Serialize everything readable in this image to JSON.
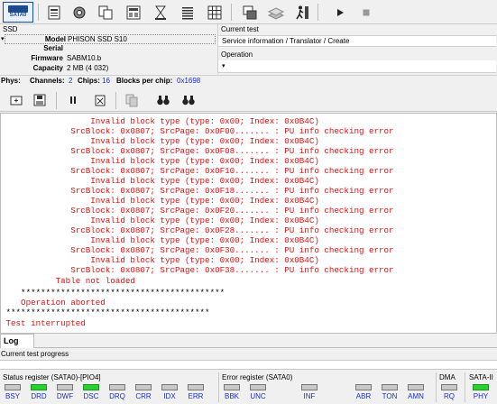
{
  "toolbar": {
    "sata_label": "SATA0",
    "icons": [
      "sata-port-icon",
      "drive-info-icon",
      "settings-icon",
      "copy-icon",
      "table-icon",
      "hourglass-icon",
      "list-icon",
      "grid-icon",
      "windows-icon",
      "stack-icon",
      "person-run-icon",
      "play-icon",
      "stop-icon"
    ]
  },
  "ssd": {
    "title": "SSD",
    "model_label": "Model",
    "model_value": "PHISON SSD S10",
    "serial_label": "Serial",
    "serial_value": "",
    "firmware_label": "Firmware",
    "firmware_value": "SABM10.b",
    "capacity_label": "Capacity",
    "capacity_value": "2 MB (4 032)"
  },
  "current_test": {
    "label": "Current test",
    "value": "Service information / Translator / Create",
    "operation_label": "Operation",
    "operation_value": ""
  },
  "phys": {
    "phys_label": "Phys:",
    "channels_label": "Channels:",
    "channels_value": "2",
    "chips_label": "Chips:",
    "chips_value": "16",
    "blocks_label": "Blocks per chip:",
    "blocks_value": "0x1698"
  },
  "log": {
    "lines": [
      {
        "text": "                  Invalid block type (type: 0x00; Index: 0x0B4C)",
        "color": "red"
      },
      {
        "text": "              SrcBlock: 0x0807; SrcPage: 0x0F00....... : PU info checking error",
        "color": "red"
      },
      {
        "text": "                  Invalid block type (type: 0x00; Index: 0x0B4C)",
        "color": "red"
      },
      {
        "text": "              SrcBlock: 0x0807; SrcPage: 0x0F08....... : PU info checking error",
        "color": "red"
      },
      {
        "text": "                  Invalid block type (type: 0x00; Index: 0x0B4C)",
        "color": "red"
      },
      {
        "text": "              SrcBlock: 0x0807; SrcPage: 0x0F10....... : PU info checking error",
        "color": "red"
      },
      {
        "text": "                  Invalid block type (type: 0x00; Index: 0x0B4C)",
        "color": "red"
      },
      {
        "text": "              SrcBlock: 0x0807; SrcPage: 0x0F18....... : PU info checking error",
        "color": "red"
      },
      {
        "text": "                  Invalid block type (type: 0x00; Index: 0x0B4C)",
        "color": "red"
      },
      {
        "text": "              SrcBlock: 0x0807; SrcPage: 0x0F20....... : PU info checking error",
        "color": "red"
      },
      {
        "text": "                  Invalid block type (type: 0x00; Index: 0x0B4C)",
        "color": "red"
      },
      {
        "text": "              SrcBlock: 0x0807; SrcPage: 0x0F28....... : PU info checking error",
        "color": "red"
      },
      {
        "text": "                  Invalid block type (type: 0x00; Index: 0x0B4C)",
        "color": "red"
      },
      {
        "text": "              SrcBlock: 0x0807; SrcPage: 0x0F30....... : PU info checking error",
        "color": "red"
      },
      {
        "text": "                  Invalid block type (type: 0x00; Index: 0x0B4C)",
        "color": "red"
      },
      {
        "text": "              SrcBlock: 0x0807; SrcPage: 0x0F38....... : PU info checking error",
        "color": "red"
      },
      {
        "text": "           Table not loaded",
        "color": "red"
      },
      {
        "text": "    *****************************************",
        "color": "black"
      },
      {
        "text": "    Operation aborted",
        "color": "red"
      },
      {
        "text": " *****************************************",
        "color": "black"
      },
      {
        "text": " Test interrupted",
        "color": "red"
      }
    ]
  },
  "tabs": {
    "log_label": "Log"
  },
  "progress": {
    "label": "Current test progress",
    "fraction": 0
  },
  "status_register": {
    "title": "Status register (SATA0)-[PIO4]",
    "flags": [
      {
        "name": "BSY",
        "on": false
      },
      {
        "name": "DRD",
        "on": true
      },
      {
        "name": "DWF",
        "on": false
      },
      {
        "name": "DSC",
        "on": true
      },
      {
        "name": "DRQ",
        "on": false
      },
      {
        "name": "CRR",
        "on": false
      },
      {
        "name": "IDX",
        "on": false
      },
      {
        "name": "ERR",
        "on": false
      }
    ]
  },
  "error_register": {
    "title": "Error register (SATA0)",
    "flags": [
      {
        "name": "BBK",
        "on": false
      },
      {
        "name": "UNC",
        "on": false
      },
      {
        "name": "INF",
        "on": false
      },
      {
        "name": "ABR",
        "on": false
      },
      {
        "name": "TON",
        "on": false
      },
      {
        "name": "AMN",
        "on": false
      }
    ]
  },
  "dma_register": {
    "title": "DMA",
    "flags": [
      {
        "name": "RQ",
        "on": false
      }
    ]
  },
  "sata_register": {
    "title": "SATA-II",
    "flags": [
      {
        "name": "PHY",
        "on": true
      }
    ]
  },
  "colors": {
    "log_red": "#e01010",
    "led_green": "#24d32e",
    "accent_blue": "#1a2fc9"
  }
}
